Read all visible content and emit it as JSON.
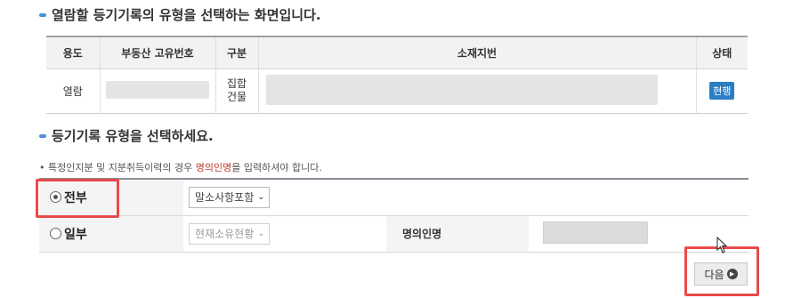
{
  "titles": {
    "select_screen": "열람할 등기기록의 유형을 선택하는 화면입니다.",
    "select_type": "등기기록 유형을 선택하세요."
  },
  "property_table": {
    "headers": [
      "용도",
      "부동산 고유번호",
      "구분",
      "소재지번",
      "상태"
    ],
    "row": {
      "purpose": "열람",
      "category": "집합건물",
      "status": "현행"
    }
  },
  "notice": {
    "prefix": "• 특정인지분 및 지분취득이력의 경우 ",
    "highlight": "명의인명",
    "suffix": "을 입력하셔야 합니다."
  },
  "options": {
    "full": {
      "label": "전부",
      "selected": true,
      "select_value": "말소사항포함"
    },
    "partial": {
      "label": "일부",
      "selected": false,
      "select_value": "현재소유현황",
      "name_label": "명의인명"
    }
  },
  "next_button": "다음",
  "icons": {
    "bullet": "bullet-icon",
    "chevron": "chevron-down-icon",
    "play": "play-circle-icon",
    "cursor": "mouse-cursor-icon"
  },
  "colors": {
    "accent": "#4a90d9",
    "status_button": "#2a7fc4",
    "highlight_box": "#e84a4a",
    "notice_highlight": "#c0392b"
  }
}
